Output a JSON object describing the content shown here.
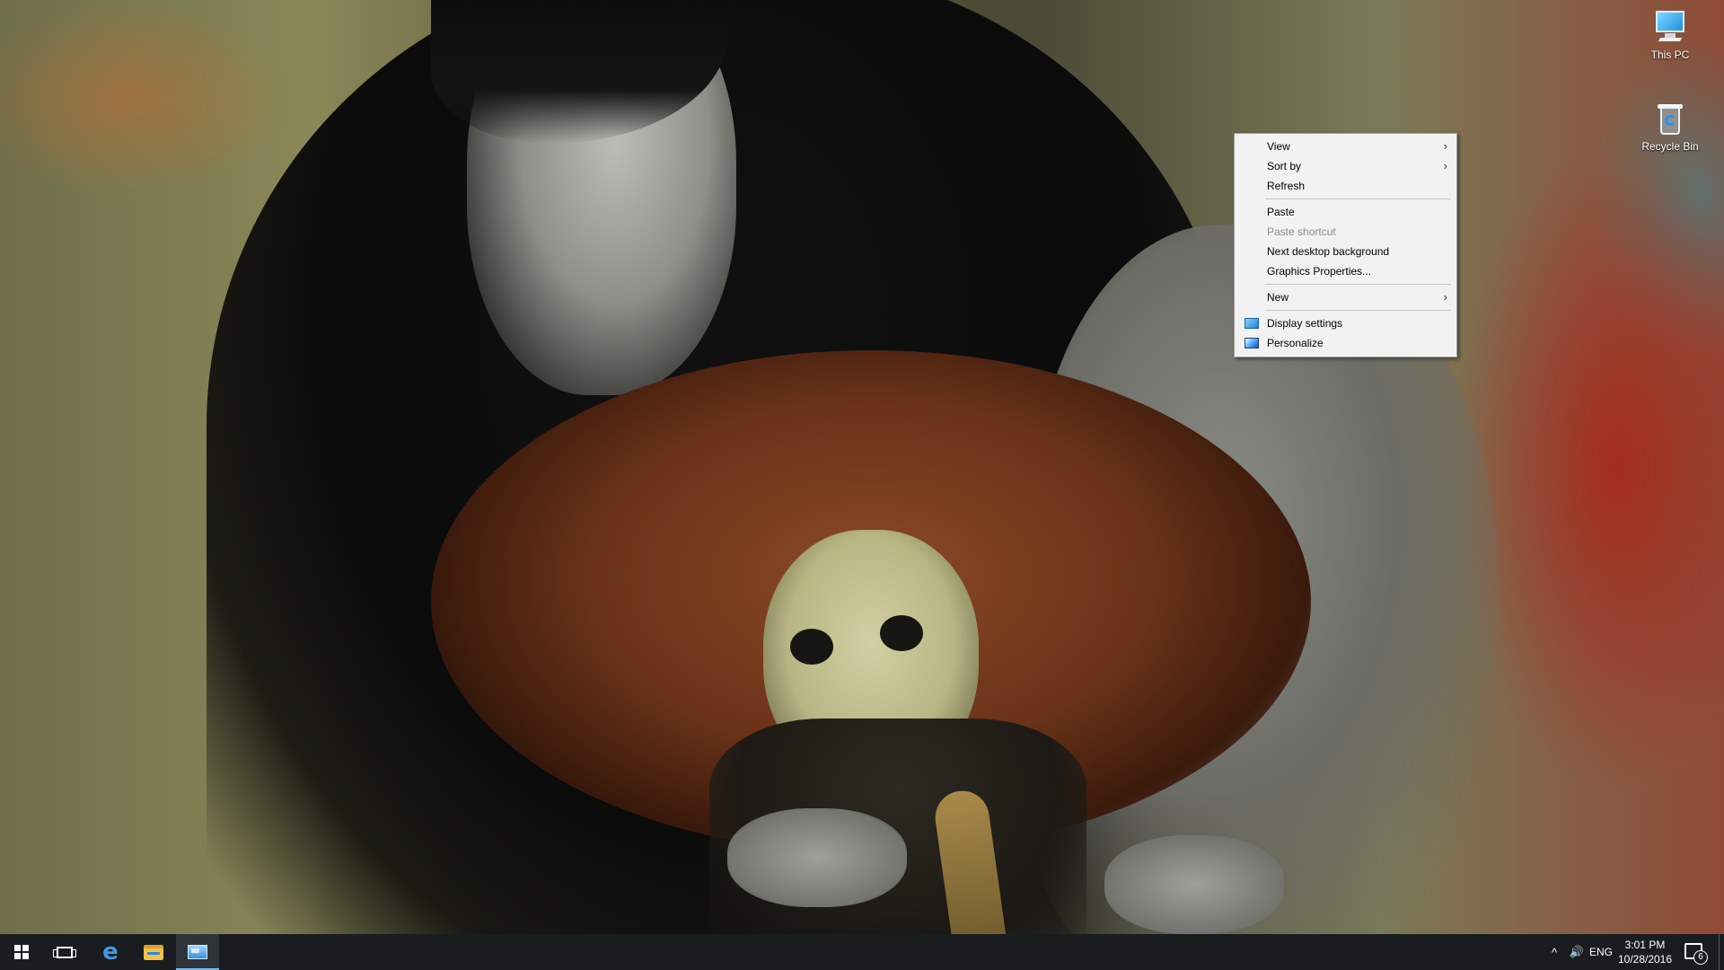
{
  "desktop": {
    "icons": [
      {
        "label": "This PC",
        "icon": "computer-icon"
      },
      {
        "label": "Recycle Bin",
        "icon": "recycle-bin-icon"
      }
    ]
  },
  "context_menu": {
    "items": [
      {
        "label": "View",
        "submenu": true,
        "enabled": true
      },
      {
        "label": "Sort by",
        "submenu": true,
        "enabled": true
      },
      {
        "label": "Refresh",
        "submenu": false,
        "enabled": true
      },
      {
        "label": "Paste",
        "submenu": false,
        "enabled": true
      },
      {
        "label": "Paste shortcut",
        "submenu": false,
        "enabled": false
      },
      {
        "label": "Next desktop background",
        "submenu": false,
        "enabled": true
      },
      {
        "label": "Graphics Properties...",
        "submenu": false,
        "enabled": true
      },
      {
        "label": "New",
        "submenu": true,
        "enabled": true
      },
      {
        "label": "Display settings",
        "submenu": false,
        "enabled": true,
        "icon": "display-settings-icon"
      },
      {
        "label": "Personalize",
        "submenu": false,
        "enabled": true,
        "icon": "personalize-icon"
      }
    ],
    "chevron": "›"
  },
  "taskbar": {
    "pinned": [
      {
        "name": "Start",
        "icon": "windows-logo-icon"
      },
      {
        "name": "Task View",
        "icon": "task-view-icon"
      },
      {
        "name": "Microsoft Edge",
        "icon": "edge-icon",
        "glyph": "e"
      },
      {
        "name": "File Explorer",
        "icon": "file-explorer-icon"
      },
      {
        "name": "Active application",
        "icon": "app-window-icon",
        "active": true
      }
    ],
    "tray": {
      "chevron": "^",
      "volume_glyph": "🔊",
      "language": "ENG",
      "time": "3:01 PM",
      "date": "10/28/2016",
      "notification_count": "6"
    }
  },
  "colors": {
    "taskbar": "#1a1d1f",
    "menu_bg": "#f2f2f2",
    "accent": "#76b9ed"
  }
}
